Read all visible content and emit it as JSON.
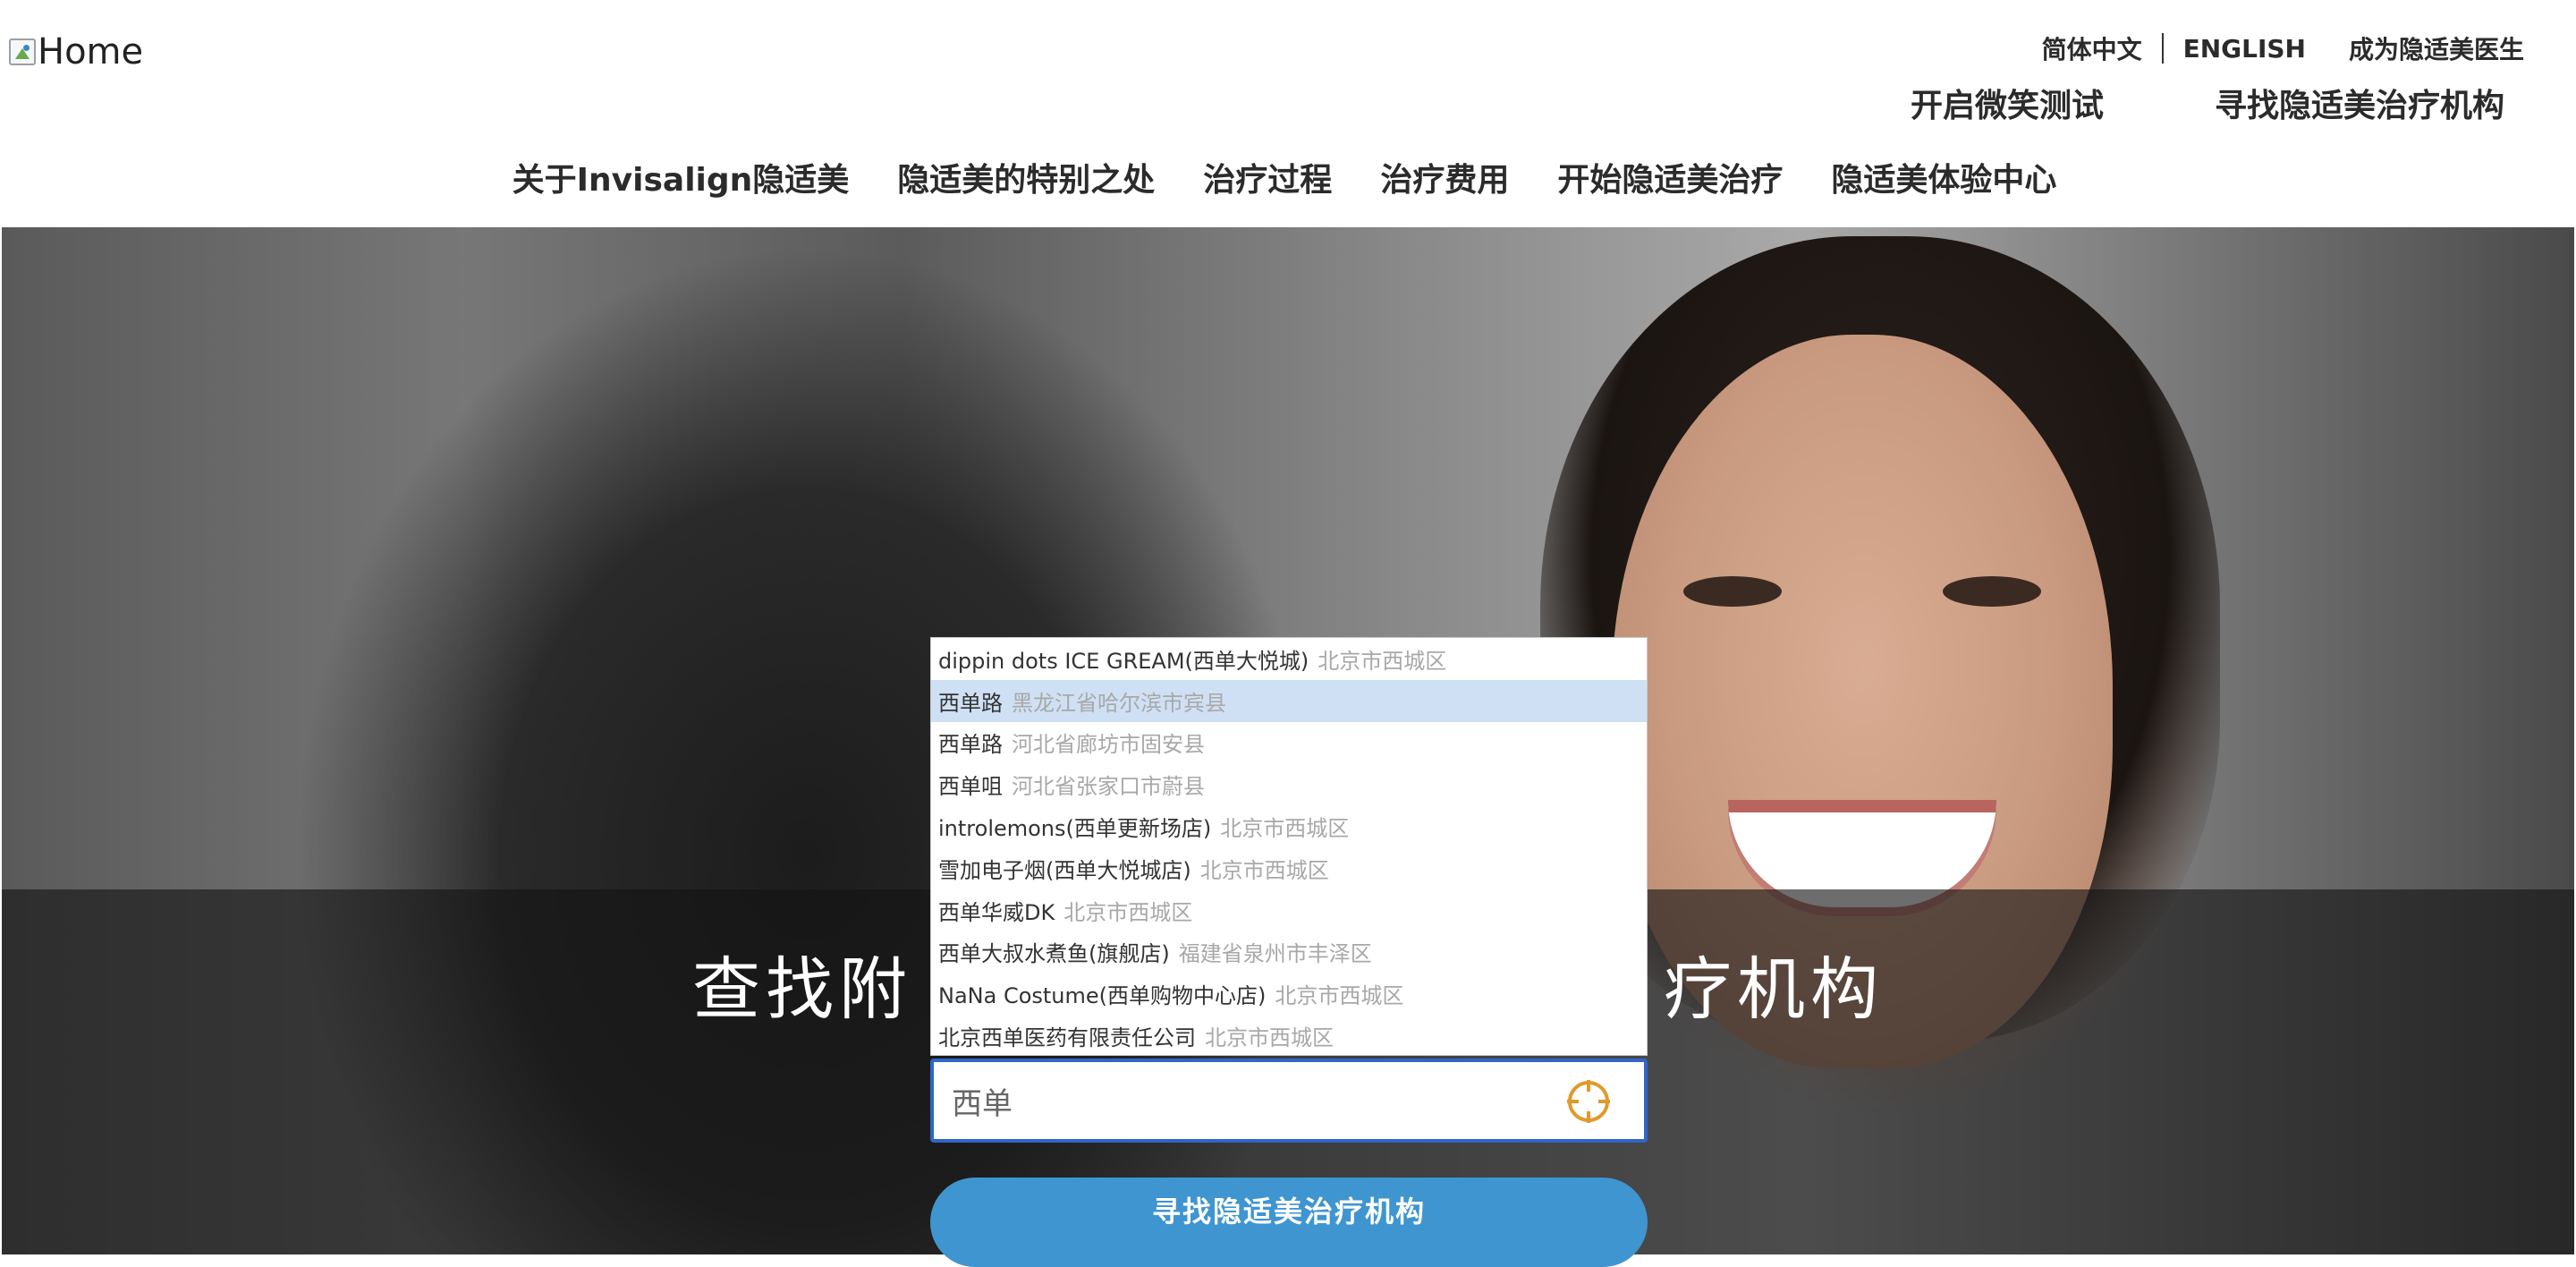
{
  "header": {
    "logo_alt": "Home",
    "util_nav": {
      "lang_zh": "简体中文",
      "lang_en": "ENGLISH",
      "become_doctor": "成为隐适美医生"
    },
    "primary_cta": {
      "smile_test": "开启微笑测试",
      "find_provider": "寻找隐适美治疗机构"
    },
    "main_nav": [
      {
        "label": "关于Invisalign隐适美"
      },
      {
        "label": "隐适美的特别之处"
      },
      {
        "label": "治疗过程"
      },
      {
        "label": "治疗费用"
      },
      {
        "label": "开始隐适美治疗"
      },
      {
        "label": "隐适美体验中心"
      }
    ]
  },
  "hero": {
    "title_left": "查找附",
    "title_right": "疗机构"
  },
  "search": {
    "query": "西单",
    "suggestions": [
      {
        "name": "dippin dots ICE GREAM(西单大悦城)",
        "address": "北京市西城区"
      },
      {
        "name": "西单路",
        "address": "黑龙江省哈尔滨市宾县",
        "active": true
      },
      {
        "name": "西单路",
        "address": "河北省廊坊市固安县"
      },
      {
        "name": "西单咀",
        "address": "河北省张家口市蔚县"
      },
      {
        "name": "introlemons(西单更新场店)",
        "address": "北京市西城区"
      },
      {
        "name": "雪加电子烟(西单大悦城店)",
        "address": "北京市西城区"
      },
      {
        "name": "西单华威DK",
        "address": "北京市西城区"
      },
      {
        "name": "西单大叔水煮鱼(旗舰店)",
        "address": "福建省泉州市丰泽区"
      },
      {
        "name": "NaNa Costume(西单购物中心店)",
        "address": "北京市西城区"
      },
      {
        "name": "北京西单医药有限责任公司",
        "address": "北京市西城区"
      }
    ],
    "submit_label": "寻找隐适美治疗机构",
    "locate_icon": "crosshair-locate-icon",
    "colors": {
      "input_border": "#2f66c8",
      "locate_icon": "#e09a2a",
      "submit_bg": "#3f95cf",
      "active_suggestion_bg": "#cfe0f5"
    }
  }
}
